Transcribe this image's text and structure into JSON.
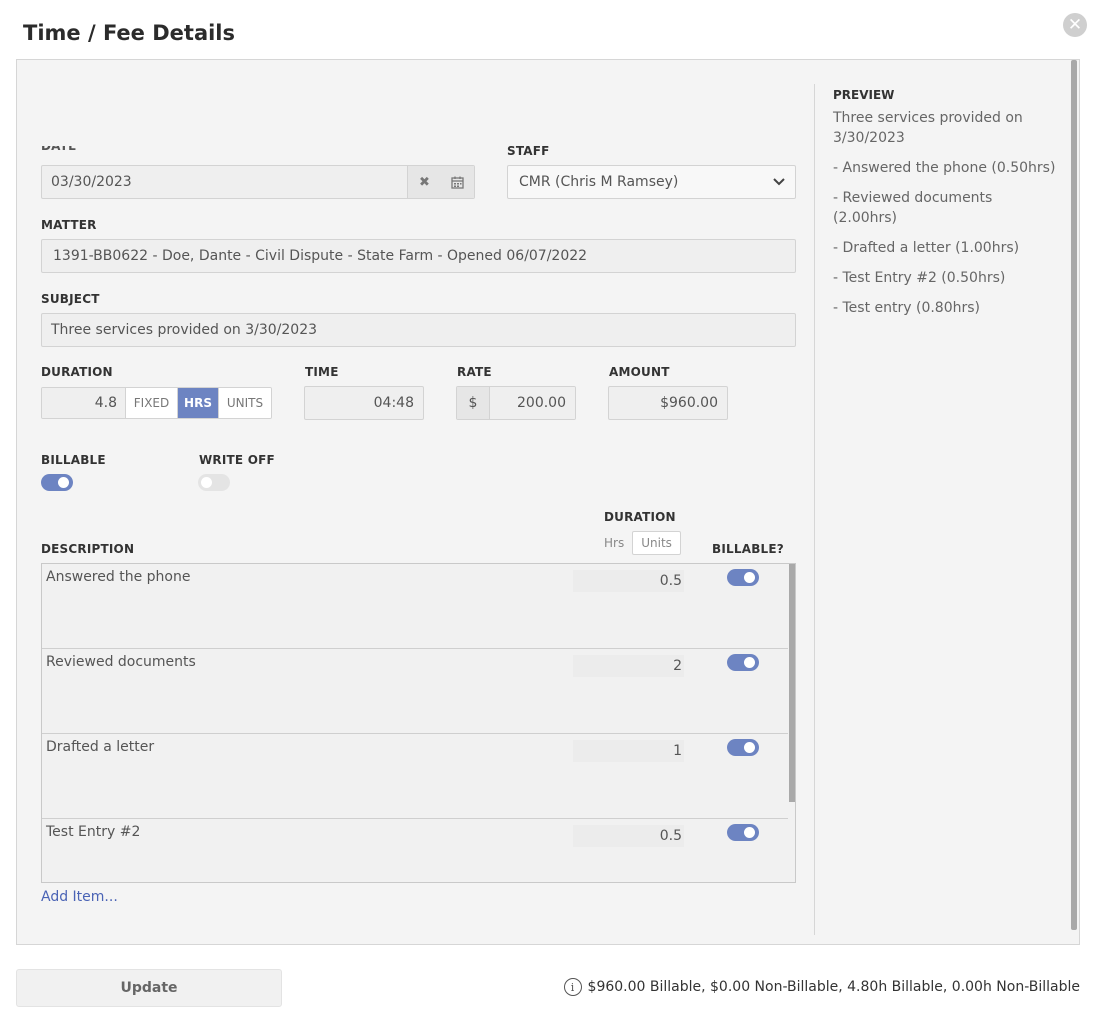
{
  "dialog": {
    "title": "Time / Fee Details",
    "close_icon": "close-icon"
  },
  "form": {
    "date": {
      "label": "DATE",
      "value": "03/30/2023"
    },
    "staff": {
      "label": "STAFF",
      "value": "CMR (Chris M Ramsey)"
    },
    "matter": {
      "label": "MATTER",
      "value": "1391-BB0622 - Doe, Dante - Civil Dispute - State Farm - Opened 06/07/2022"
    },
    "subject": {
      "label": "SUBJECT",
      "value": "Three services provided on 3/30/2023"
    },
    "duration": {
      "label": "DURATION",
      "value": "4.8",
      "modes": [
        "FIXED",
        "HRS",
        "UNITS"
      ],
      "active_mode": "HRS"
    },
    "time": {
      "label": "TIME",
      "value": "04:48"
    },
    "rate": {
      "label": "RATE",
      "currency": "$",
      "value": "200.00"
    },
    "amount": {
      "label": "AMOUNT",
      "value": "$960.00"
    },
    "billable": {
      "label": "BILLABLE",
      "on": true
    },
    "write_off": {
      "label": "WRITE OFF",
      "on": false
    }
  },
  "items": {
    "description_header": "DESCRIPTION",
    "duration_header": "DURATION",
    "billable_header": "BILLABLE?",
    "unit_options": [
      "Hrs",
      "Units"
    ],
    "rows": [
      {
        "description": "Answered the phone",
        "duration": "0.5",
        "billable": true
      },
      {
        "description": "Reviewed documents",
        "duration": "2",
        "billable": true
      },
      {
        "description": "Drafted a letter",
        "duration": "1",
        "billable": true
      },
      {
        "description": "Test Entry #2",
        "duration": "0.5",
        "billable": true
      }
    ],
    "add_label": "Add Item..."
  },
  "preview": {
    "title": "PREVIEW",
    "subject": "Three services provided on 3/30/2023",
    "lines": [
      "- Answered the phone (0.50hrs)",
      "- Reviewed documents (2.00hrs)",
      "- Drafted a letter (1.00hrs)",
      "- Test Entry #2 (0.50hrs)",
      "- Test entry (0.80hrs)"
    ]
  },
  "footer": {
    "update_label": "Update",
    "summary": "$960.00 Billable, $0.00 Non-Billable, 4.80h Billable, 0.00h Non-Billable"
  },
  "colors": {
    "accent": "#6d84c2",
    "link": "#4a63b5"
  }
}
